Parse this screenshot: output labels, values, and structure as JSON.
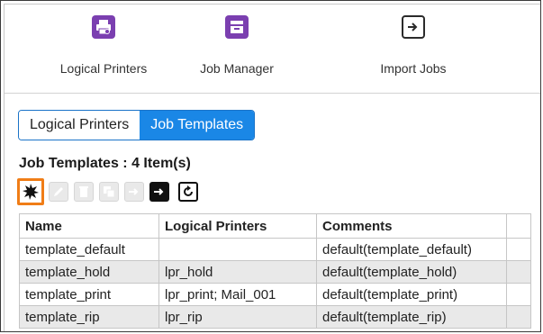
{
  "toolbar": {
    "items": [
      {
        "label": "Logical Printers",
        "icon": "printer-settings-icon"
      },
      {
        "label": "Job Manager",
        "icon": "job-manager-icon"
      },
      {
        "label": "Import Jobs",
        "icon": "import-icon"
      }
    ]
  },
  "tabs": [
    {
      "label": "Logical Printers",
      "active": false
    },
    {
      "label": "Job Templates",
      "active": true
    }
  ],
  "section": {
    "title": "Job Templates : 4 Item(s)"
  },
  "actions": [
    {
      "icon": "new-icon",
      "enabled": true,
      "selected": true
    },
    {
      "icon": "edit-icon",
      "enabled": false
    },
    {
      "icon": "delete-icon",
      "enabled": false
    },
    {
      "icon": "copy-icon",
      "enabled": false
    },
    {
      "icon": "export-icon",
      "enabled": false
    },
    {
      "icon": "import-icon",
      "enabled": true
    },
    {
      "icon": "refresh-icon",
      "enabled": true
    }
  ],
  "table": {
    "headers": [
      "Name",
      "Logical Printers",
      "Comments",
      ""
    ],
    "rows": [
      [
        "template_default",
        "",
        "default(template_default)",
        ""
      ],
      [
        "template_hold",
        "lpr_hold",
        "default(template_hold)",
        ""
      ],
      [
        "template_print",
        "lpr_print; Mail_001",
        "default(template_print)",
        ""
      ],
      [
        "template_rip",
        "lpr_rip",
        "default(template_rip)",
        ""
      ]
    ]
  },
  "colors": {
    "accent": "#1a87e6",
    "selection": "#f07d17",
    "icon_purple": "#7b3fb0"
  }
}
